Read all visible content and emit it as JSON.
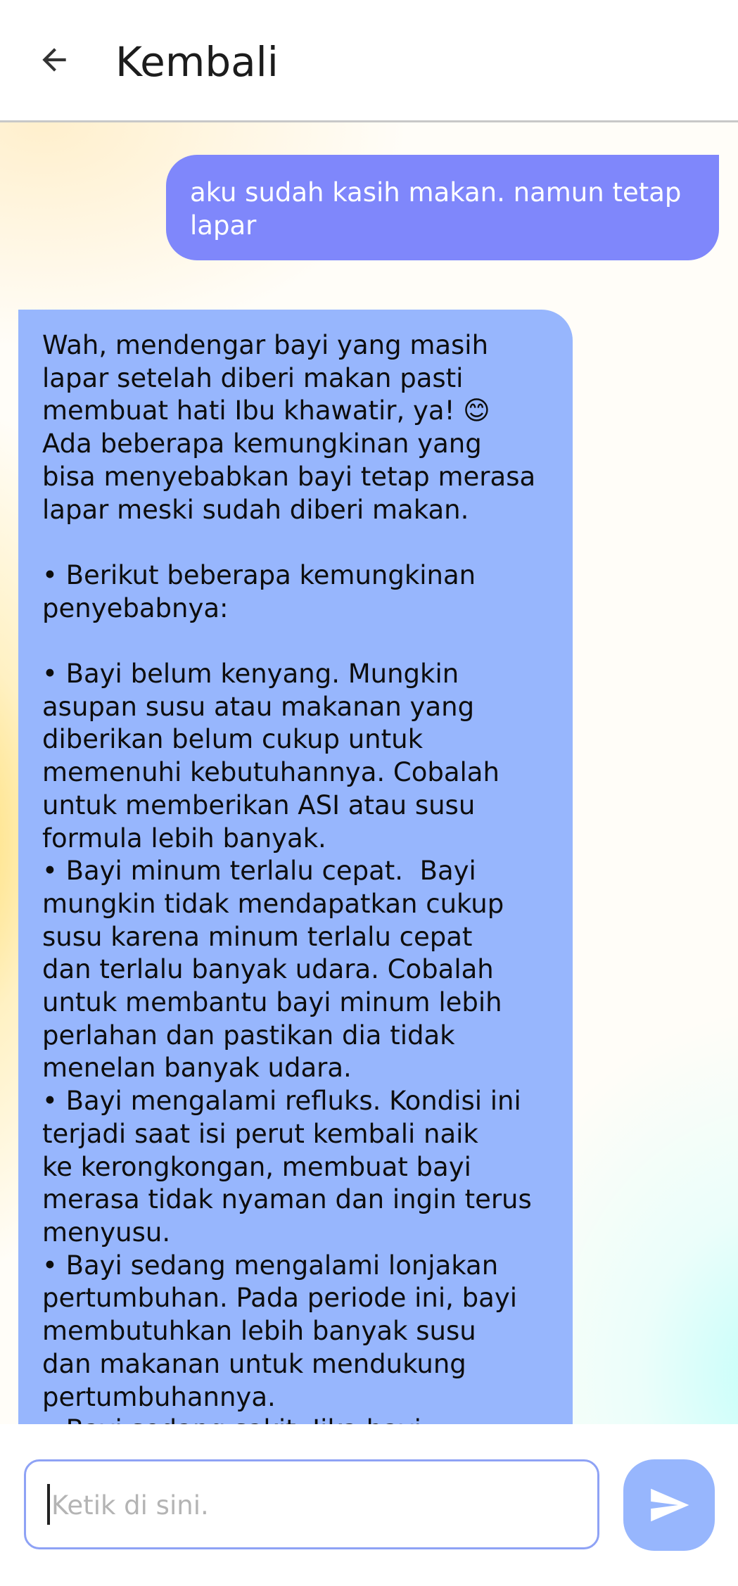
{
  "header": {
    "title": "Kembali",
    "back_icon": "arrow-left-icon"
  },
  "messages": [
    {
      "sender": "user",
      "text": "aku sudah kasih makan. namun tetap\nlapar"
    },
    {
      "sender": "assistant",
      "text": "Wah, mendengar bayi yang masih\nlapar setelah diberi makan pasti\nmembuat hati Ibu khawatir, ya! 😊\nAda beberapa kemungkinan yang\nbisa menyebabkan bayi tetap merasa\nlapar meski sudah diberi makan.\n\n• Berikut beberapa kemungkinan\npenyebabnya:\n\n• Bayi belum kenyang. Mungkin\nasupan susu atau makanan yang\ndiberikan belum cukup untuk\nmemenuhi kebutuhannya. Cobalah\nuntuk memberikan ASI atau susu\nformula lebih banyak.\n• Bayi minum terlalu cepat.  Bayi\nmungkin tidak mendapatkan cukup\nsusu karena minum terlalu cepat\ndan terlalu banyak udara. Cobalah\nuntuk membantu bayi minum lebih\nperlahan dan pastikan dia tidak\nmenelan banyak udara.\n• Bayi mengalami refluks. Kondisi ini\nterjadi saat isi perut kembali naik\nke kerongkongan, membuat bayi\nmerasa tidak nyaman dan ingin terus\nmenyusu.\n• Bayi sedang mengalami lonjakan\npertumbuhan. Pada periode ini, bayi\nmembutuhkan lebih banyak susu\ndan makanan untuk mendukung\npertumbuhannya.\n• Bayi sedang sakit. Jika bayi"
    }
  ],
  "composer": {
    "placeholder": "Ketik di sini.",
    "value": "",
    "send_icon": "send-icon"
  },
  "colors": {
    "user_bubble": "#7f87fb",
    "assistant_bubble": "#97b6fd",
    "send_button": "#97b6fd",
    "input_border": "#8ea2f5"
  }
}
